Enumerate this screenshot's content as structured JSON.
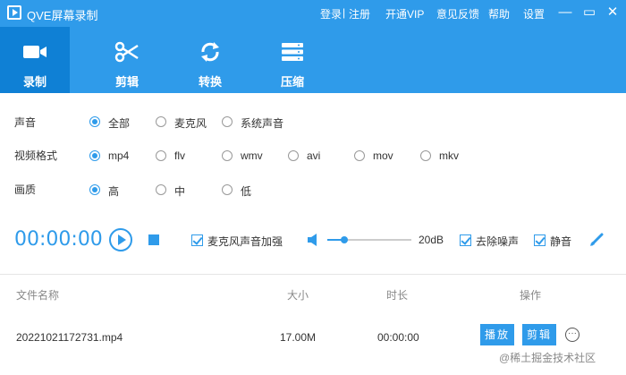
{
  "app": {
    "title": "QVE屏幕录制"
  },
  "header_links": {
    "login": "登录",
    "separator": "|",
    "register": "注册",
    "vip": "开通VIP",
    "feedback": "意见反馈",
    "help": "帮助",
    "settings": "设置"
  },
  "window_controls": {
    "minimize": "—",
    "maximize": "▭",
    "close": "✕"
  },
  "toolbar": [
    {
      "label": "录制",
      "icon": "video-camera-icon",
      "active": true
    },
    {
      "label": "剪辑",
      "icon": "scissors-icon",
      "active": false
    },
    {
      "label": "转换",
      "icon": "refresh-icon",
      "active": false
    },
    {
      "label": "压缩",
      "icon": "compress-icon",
      "active": false
    }
  ],
  "options": {
    "sound": {
      "label": "声音",
      "choices": [
        "全部",
        "麦克风",
        "系统声音"
      ],
      "selected": "全部"
    },
    "format": {
      "label": "视频格式",
      "choices": [
        "mp4",
        "flv",
        "wmv",
        "avi",
        "mov",
        "mkv"
      ],
      "selected": "mp4"
    },
    "quality": {
      "label": "画质",
      "choices": [
        "高",
        "中",
        "低"
      ],
      "selected": "高"
    }
  },
  "record": {
    "timer": "00:00:00",
    "mic_boost": {
      "label": "麦克风声音加强",
      "checked": true
    },
    "volume_db": "20dB",
    "volume_level": 0.2,
    "noise_reduction": {
      "label": "去除噪声",
      "checked": true
    },
    "mute": {
      "label": "静音",
      "checked": true
    }
  },
  "table": {
    "headers": {
      "name": "文件名称",
      "size": "大小",
      "duration": "时长",
      "actions": "操作"
    },
    "rows": [
      {
        "name": "20221021172731.mp4",
        "size": "17.00M",
        "duration": "00:00:00"
      }
    ],
    "play_label": "播放",
    "edit_label": "剪辑",
    "more": "···"
  },
  "watermark": "@稀土掘金技术社区",
  "colors": {
    "accent": "#2f9bea",
    "active_tab": "#0f80d5"
  }
}
